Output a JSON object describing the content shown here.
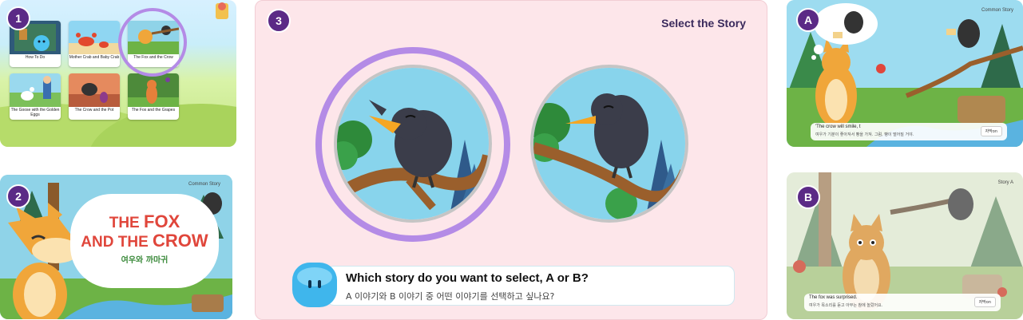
{
  "badges": {
    "one": "1",
    "two": "2",
    "three": "3",
    "a": "A",
    "b": "B"
  },
  "panel1": {
    "stories": [
      {
        "title": "How To Do"
      },
      {
        "title": "Mother Crab and Baby Crab"
      },
      {
        "title": "The Fox and the Crow"
      },
      {
        "title": "The Goose with the Golden Eggs"
      },
      {
        "title": "The Crow and the Pot"
      },
      {
        "title": "The Fox and the Grapes"
      }
    ]
  },
  "panel2": {
    "tag": "Common Story",
    "title_the1": "THE",
    "title_fox": "FOX",
    "title_and": "AND THE",
    "title_crow": "CROW",
    "korean_title": "여우와 까마귀"
  },
  "panel3": {
    "heading": "Select the Story",
    "question": "Which story do you want to select, A or B?",
    "question_ko": "A 이야기와 B 이야기 중 어떤 이야기를 선택하고 싶나요?"
  },
  "panelA": {
    "tag": "Common Story",
    "subtitle_en": "'The crow will smile, t",
    "subtitle_ko": "여우가 기분이 좋아져서 빵을 가져. 그럼, 빵이 떨어질 거야.",
    "button": "자막on"
  },
  "panelB": {
    "tag": "Story A",
    "subtitle_en": "The fox was surprised.",
    "subtitle_ko": "여우가 목소리를 듣고 아무는 참에 놀랐어요.",
    "button": "자막on"
  },
  "colors": {
    "badge": "#5b2a86",
    "ring": "#b48be6",
    "crow_orange": "#f5a623",
    "fox": "#f0a63a"
  }
}
